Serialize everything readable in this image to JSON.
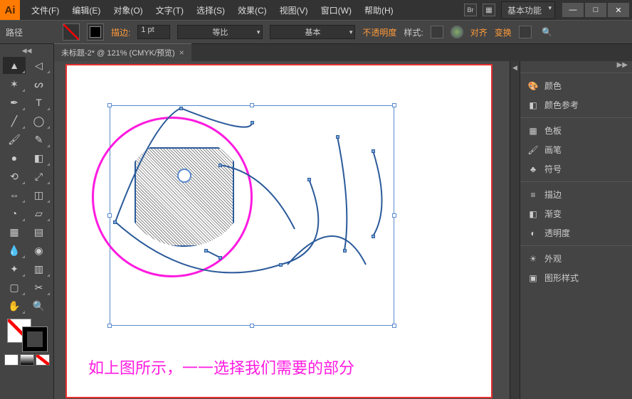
{
  "app": {
    "initials": "Ai"
  },
  "menu": {
    "file": "文件(F)",
    "edit": "编辑(E)",
    "object": "对象(O)",
    "type": "文字(T)",
    "select": "选择(S)",
    "effect": "效果(C)",
    "view": "视图(V)",
    "window": "窗口(W)",
    "help": "帮助(H)"
  },
  "workspace": {
    "label": "基本功能"
  },
  "control": {
    "path_label": "路径",
    "stroke_label": "描边:",
    "stroke_weight": "1 pt",
    "profile": "等比",
    "brush": "基本",
    "opacity_label": "不透明度",
    "style_label": "样式:",
    "align_label": "对齐",
    "transform_label": "变换"
  },
  "tab": {
    "title": "未标题-2* @ 121% (CMYK/预览)"
  },
  "canvas": {
    "caption": "如上图所示，一一选择我们需要的部分"
  },
  "panels": {
    "color": "颜色",
    "color_guide": "颜色参考",
    "swatches": "色板",
    "brushes": "画笔",
    "symbols": "符号",
    "stroke": "描边",
    "gradient": "渐变",
    "transparency": "透明度",
    "appearance": "外观",
    "graphic_styles": "图形样式"
  },
  "tools": {
    "selection": "selection",
    "direct": "direct-selection",
    "wand": "magic-wand",
    "lasso": "lasso",
    "pen": "pen",
    "type": "type",
    "line": "line",
    "ellipse": "ellipse",
    "paintbrush": "paintbrush",
    "pencil": "pencil",
    "blob": "blob-brush",
    "eraser": "eraser",
    "rotate": "rotate",
    "scale": "scale",
    "width": "width",
    "free": "free-transform",
    "shape_builder": "shape-builder",
    "perspective": "perspective",
    "mesh": "mesh",
    "gradient_t": "gradient",
    "eyedropper": "eyedropper",
    "blend": "blend",
    "symbol_sprayer": "symbol-sprayer",
    "graph": "column-graph",
    "artboard": "artboard",
    "slice": "slice",
    "hand": "hand",
    "zoom": "zoom"
  }
}
